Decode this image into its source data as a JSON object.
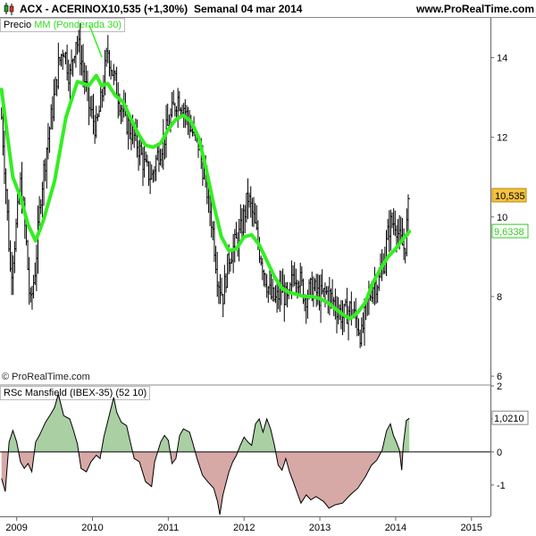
{
  "header": {
    "icon": "candle-icon",
    "symbol": "ACX - ACERINOX",
    "price_change": "10,535 (+1,30%)",
    "period_date": "Semanal  04 mar 2014",
    "site": "www.ProRealTime.com"
  },
  "price_panel": {
    "label_price": "Precio",
    "label_ma": "MM (Ponderada 30)",
    "copyright": "© ProRealTime.com"
  },
  "rsc_panel": {
    "label": "RSc Mansfield (IBEX-35) (52 10)"
  },
  "colors": {
    "ma_line": "#33ee22",
    "rsc_positive_fill": "#a9cfa3",
    "rsc_negative_fill": "#d7a9a6",
    "last_price_badge": "#f5c242",
    "ma_badge_text": "#33cc22"
  },
  "chart_data": [
    {
      "type": "line",
      "title": "ACX - ACERINOX",
      "y_ticks": [
        "6",
        "8",
        "10",
        "12",
        "14"
      ],
      "x_ticks": [
        "2009",
        "2010",
        "2011",
        "2012",
        "2013",
        "2014",
        "2015"
      ],
      "ylim": [
        5.8,
        15.0
      ],
      "xlim": [
        2008.78,
        2015.25
      ],
      "grid": false,
      "last_price_label": "10,535",
      "last_ma_label": "9,6338",
      "series": [
        {
          "name": "Precio",
          "type": "hlc_weekly",
          "anchors": [
            [
              2008.8,
              12.5
            ],
            [
              2008.85,
              11.0
            ],
            [
              2008.92,
              8.5
            ],
            [
              2008.98,
              9.5
            ],
            [
              2009.05,
              10.8
            ],
            [
              2009.12,
              9.5
            ],
            [
              2009.18,
              7.7
            ],
            [
              2009.25,
              8.8
            ],
            [
              2009.32,
              10.6
            ],
            [
              2009.4,
              11.8
            ],
            [
              2009.48,
              12.8
            ],
            [
              2009.55,
              13.8
            ],
            [
              2009.62,
              14.3
            ],
            [
              2009.7,
              13.5
            ],
            [
              2009.78,
              14.5
            ],
            [
              2009.85,
              14.0
            ],
            [
              2009.95,
              12.8
            ],
            [
              2010.05,
              12.2
            ],
            [
              2010.12,
              13.0
            ],
            [
              2010.2,
              14.2
            ],
            [
              2010.28,
              13.5
            ],
            [
              2010.35,
              13.0
            ],
            [
              2010.42,
              12.5
            ],
            [
              2010.5,
              12.2
            ],
            [
              2010.6,
              11.8
            ],
            [
              2010.7,
              11.2
            ],
            [
              2010.78,
              11.0
            ],
            [
              2010.85,
              11.5
            ],
            [
              2010.95,
              12.0
            ],
            [
              2011.05,
              12.6
            ],
            [
              2011.12,
              13.0
            ],
            [
              2011.2,
              12.8
            ],
            [
              2011.3,
              12.2
            ],
            [
              2011.4,
              11.8
            ],
            [
              2011.5,
              10.8
            ],
            [
              2011.58,
              9.8
            ],
            [
              2011.65,
              8.5
            ],
            [
              2011.72,
              8.0
            ],
            [
              2011.8,
              9.0
            ],
            [
              2011.88,
              9.3
            ],
            [
              2011.95,
              9.6
            ],
            [
              2012.05,
              10.5
            ],
            [
              2012.12,
              10.0
            ],
            [
              2012.2,
              9.2
            ],
            [
              2012.28,
              8.5
            ],
            [
              2012.35,
              8.0
            ],
            [
              2012.42,
              7.9
            ],
            [
              2012.5,
              8.2
            ],
            [
              2012.58,
              7.8
            ],
            [
              2012.65,
              8.6
            ],
            [
              2012.72,
              8.5
            ],
            [
              2012.8,
              8.0
            ],
            [
              2012.9,
              8.2
            ],
            [
              2013.0,
              8.0
            ],
            [
              2013.1,
              8.1
            ],
            [
              2013.2,
              7.8
            ],
            [
              2013.3,
              7.5
            ],
            [
              2013.4,
              7.7
            ],
            [
              2013.48,
              7.4
            ],
            [
              2013.55,
              7.0
            ],
            [
              2013.62,
              7.8
            ],
            [
              2013.7,
              8.3
            ],
            [
              2013.78,
              8.4
            ],
            [
              2013.85,
              9.0
            ],
            [
              2013.92,
              9.8
            ],
            [
              2014.0,
              9.9
            ],
            [
              2014.05,
              9.4
            ],
            [
              2014.12,
              9.2
            ],
            [
              2014.18,
              10.5
            ]
          ]
        },
        {
          "name": "MM (Ponderada 30)",
          "type": "line",
          "points": [
            [
              2008.8,
              13.2
            ],
            [
              2008.88,
              12.0
            ],
            [
              2008.95,
              11.0
            ],
            [
              2009.05,
              10.5
            ],
            [
              2009.15,
              9.8
            ],
            [
              2009.25,
              9.4
            ],
            [
              2009.35,
              9.9
            ],
            [
              2009.5,
              10.9
            ],
            [
              2009.65,
              12.5
            ],
            [
              2009.8,
              13.4
            ],
            [
              2009.95,
              13.3
            ],
            [
              2010.05,
              13.55
            ],
            [
              2010.12,
              13.3
            ],
            [
              2010.2,
              13.35
            ],
            [
              2010.3,
              13.05
            ],
            [
              2010.4,
              12.9
            ],
            [
              2010.5,
              12.5
            ],
            [
              2010.6,
              12.1
            ],
            [
              2010.7,
              11.8
            ],
            [
              2010.8,
              11.75
            ],
            [
              2010.9,
              11.85
            ],
            [
              2011.0,
              12.2
            ],
            [
              2011.1,
              12.45
            ],
            [
              2011.2,
              12.55
            ],
            [
              2011.3,
              12.4
            ],
            [
              2011.4,
              12.0
            ],
            [
              2011.5,
              11.2
            ],
            [
              2011.6,
              10.3
            ],
            [
              2011.7,
              9.5
            ],
            [
              2011.8,
              9.15
            ],
            [
              2011.9,
              9.2
            ],
            [
              2012.0,
              9.5
            ],
            [
              2012.1,
              9.55
            ],
            [
              2012.2,
              9.3
            ],
            [
              2012.3,
              8.9
            ],
            [
              2012.4,
              8.5
            ],
            [
              2012.5,
              8.2
            ],
            [
              2012.6,
              8.1
            ],
            [
              2012.7,
              8.05
            ],
            [
              2012.8,
              8.0
            ],
            [
              2012.9,
              8.0
            ],
            [
              2013.0,
              7.95
            ],
            [
              2013.1,
              7.85
            ],
            [
              2013.2,
              7.7
            ],
            [
              2013.3,
              7.55
            ],
            [
              2013.4,
              7.45
            ],
            [
              2013.5,
              7.6
            ],
            [
              2013.6,
              7.85
            ],
            [
              2013.7,
              8.35
            ],
            [
              2013.8,
              8.7
            ],
            [
              2013.9,
              9.0
            ],
            [
              2014.0,
              9.2
            ],
            [
              2014.1,
              9.45
            ],
            [
              2014.18,
              9.63
            ]
          ]
        }
      ]
    },
    {
      "type": "area",
      "title": "RSc Mansfield (IBEX-35) (52 10)",
      "y_ticks": [
        "-1",
        "0",
        "1",
        "2"
      ],
      "ylim": [
        -1.95,
        2.0
      ],
      "last_label": "1,0210",
      "series": [
        {
          "name": "RSc Mansfield (IBEX-35)",
          "points": [
            [
              2008.8,
              -0.8
            ],
            [
              2008.85,
              -1.2
            ],
            [
              2008.9,
              0.3
            ],
            [
              2008.95,
              0.65
            ],
            [
              2009.0,
              0.3
            ],
            [
              2009.05,
              -0.3
            ],
            [
              2009.1,
              -0.5
            ],
            [
              2009.15,
              -0.35
            ],
            [
              2009.2,
              -0.6
            ],
            [
              2009.25,
              0.3
            ],
            [
              2009.3,
              0.5
            ],
            [
              2009.38,
              0.9
            ],
            [
              2009.45,
              1.15
            ],
            [
              2009.5,
              1.35
            ],
            [
              2009.55,
              1.75
            ],
            [
              2009.62,
              1.1
            ],
            [
              2009.7,
              1.0
            ],
            [
              2009.75,
              0.65
            ],
            [
              2009.8,
              0.25
            ],
            [
              2009.85,
              -0.5
            ],
            [
              2009.92,
              -0.6
            ],
            [
              2009.98,
              -0.3
            ],
            [
              2010.05,
              -0.1
            ],
            [
              2010.1,
              -0.2
            ],
            [
              2010.15,
              0.45
            ],
            [
              2010.22,
              1.1
            ],
            [
              2010.28,
              1.65
            ],
            [
              2010.32,
              1.2
            ],
            [
              2010.38,
              0.9
            ],
            [
              2010.45,
              0.8
            ],
            [
              2010.5,
              0.3
            ],
            [
              2010.55,
              -0.2
            ],
            [
              2010.62,
              -0.3
            ],
            [
              2010.7,
              -0.9
            ],
            [
              2010.78,
              -1.05
            ],
            [
              2010.82,
              -0.3
            ],
            [
              2010.9,
              0.3
            ],
            [
              2010.95,
              0.5
            ],
            [
              2011.0,
              0.35
            ],
            [
              2011.05,
              -0.35
            ],
            [
              2011.1,
              -0.2
            ],
            [
              2011.15,
              0.5
            ],
            [
              2011.2,
              0.7
            ],
            [
              2011.28,
              0.6
            ],
            [
              2011.32,
              0.3
            ],
            [
              2011.38,
              -0.2
            ],
            [
              2011.45,
              -0.7
            ],
            [
              2011.52,
              -0.9
            ],
            [
              2011.6,
              -1.1
            ],
            [
              2011.65,
              -1.5
            ],
            [
              2011.68,
              -1.9
            ],
            [
              2011.72,
              -1.3
            ],
            [
              2011.8,
              -0.6
            ],
            [
              2011.85,
              -0.3
            ],
            [
              2011.9,
              -0.1
            ],
            [
              2011.95,
              0.2
            ],
            [
              2012.0,
              0.45
            ],
            [
              2012.05,
              0.3
            ],
            [
              2012.1,
              0.2
            ],
            [
              2012.15,
              0.85
            ],
            [
              2012.2,
              1.0
            ],
            [
              2012.25,
              0.6
            ],
            [
              2012.3,
              1.0
            ],
            [
              2012.35,
              0.7
            ],
            [
              2012.4,
              0.2
            ],
            [
              2012.45,
              -0.4
            ],
            [
              2012.5,
              -0.55
            ],
            [
              2012.55,
              -0.2
            ],
            [
              2012.6,
              -0.6
            ],
            [
              2012.68,
              -1.1
            ],
            [
              2012.75,
              -1.55
            ],
            [
              2012.82,
              -1.3
            ],
            [
              2012.88,
              -1.45
            ],
            [
              2012.95,
              -1.35
            ],
            [
              2013.05,
              -1.5
            ],
            [
              2013.12,
              -1.7
            ],
            [
              2013.2,
              -1.6
            ],
            [
              2013.3,
              -1.55
            ],
            [
              2013.4,
              -1.3
            ],
            [
              2013.5,
              -1.1
            ],
            [
              2013.6,
              -0.75
            ],
            [
              2013.68,
              -0.4
            ],
            [
              2013.75,
              -0.25
            ],
            [
              2013.82,
              0.05
            ],
            [
              2013.88,
              0.65
            ],
            [
              2013.93,
              0.85
            ],
            [
              2013.97,
              0.5
            ],
            [
              2014.0,
              0.35
            ],
            [
              2014.05,
              0.05
            ],
            [
              2014.08,
              -0.55
            ],
            [
              2014.1,
              0.2
            ],
            [
              2014.14,
              0.95
            ],
            [
              2014.18,
              1.02
            ]
          ]
        }
      ]
    }
  ]
}
